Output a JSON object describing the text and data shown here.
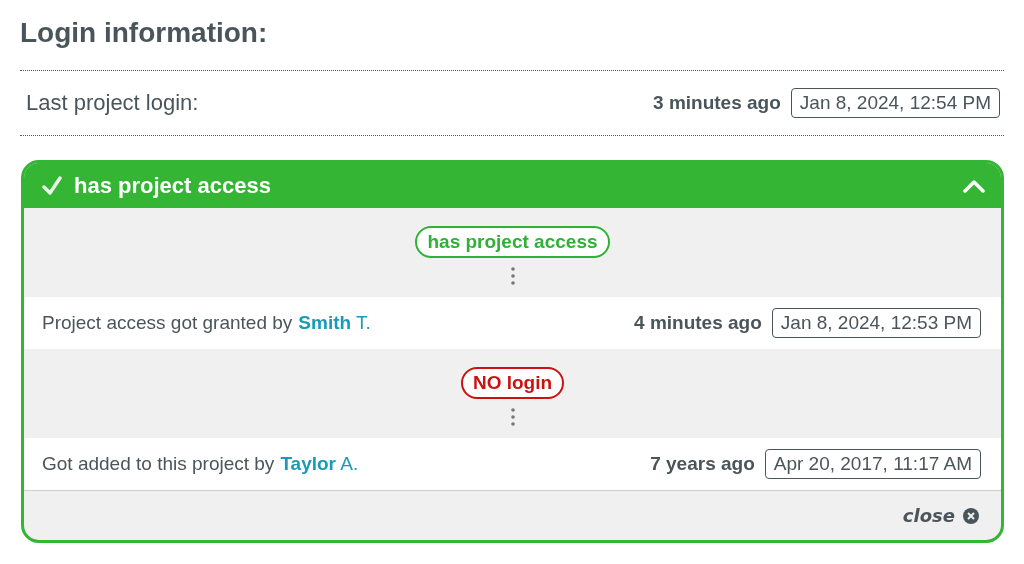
{
  "heading": "Login information:",
  "last_login": {
    "label": "Last project login:",
    "relative": "3 minutes ago",
    "timestamp": "Jan 8, 2024, 12:54 PM"
  },
  "panel": {
    "title": "has project access",
    "expanded": true,
    "events": [
      {
        "status": "has project access",
        "color": "#2eb135",
        "text": "Project access got granted by",
        "user": "**Smith** T.",
        "relative": "4 minutes ago",
        "timestamp": "Jan 8, 2024, 12:53 PM"
      },
      {
        "status": "NO login",
        "color": "#cc1111",
        "text": "Got added to this project by",
        "user": "**Taylor** A.",
        "relative": "7 years ago",
        "timestamp": "Apr 20, 2017, 11:17 AM"
      }
    ],
    "close": "close"
  }
}
